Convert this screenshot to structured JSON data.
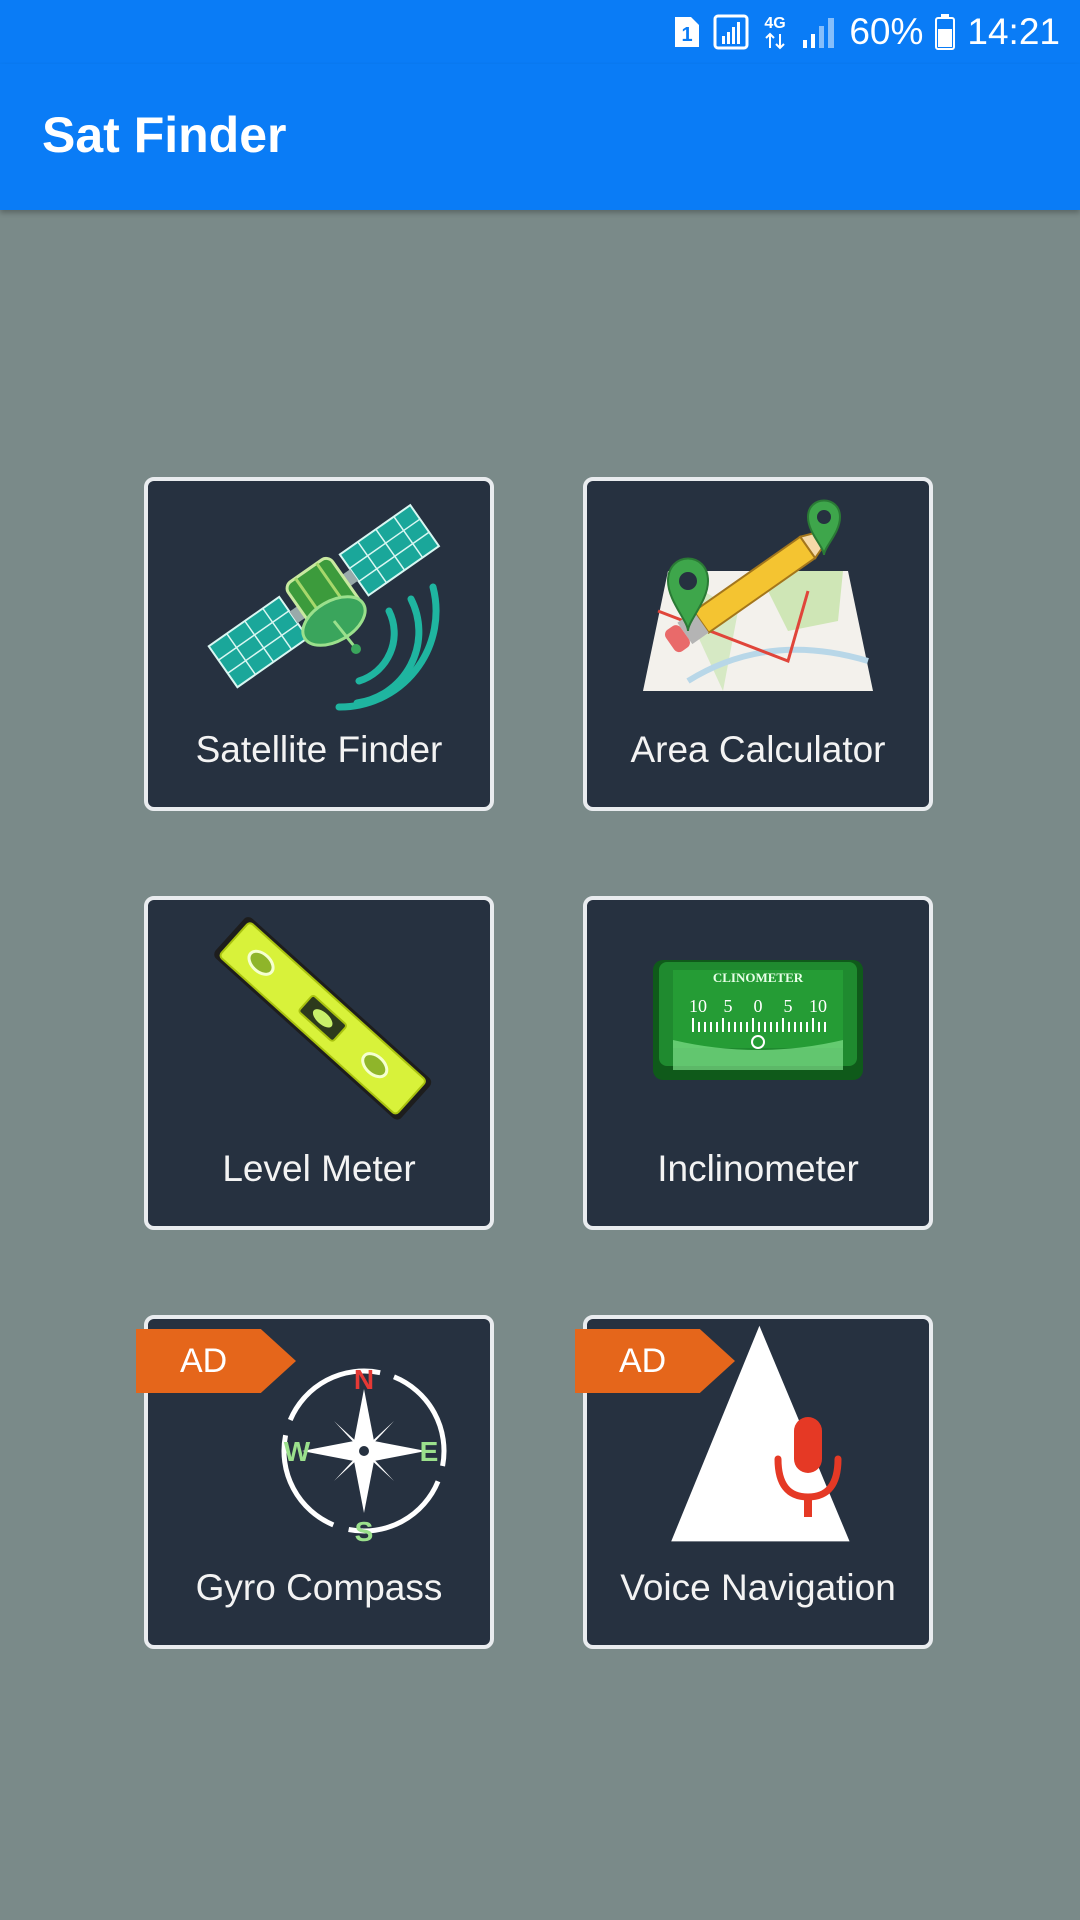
{
  "status_bar": {
    "sim_label": "1",
    "network_label": "4G",
    "battery": "60%",
    "time": "14:21",
    "icons": [
      "sim-icon",
      "signal-icon",
      "network-4g-icon",
      "signal-icon",
      "battery-icon"
    ]
  },
  "app_bar": {
    "title": "Sat Finder"
  },
  "tiles": [
    {
      "label": "Satellite Finder",
      "icon": "satellite-icon",
      "ad": ""
    },
    {
      "label": "Area Calculator",
      "icon": "map-pencil-icon",
      "ad": ""
    },
    {
      "label": "Level Meter",
      "icon": "spirit-level-icon",
      "ad": ""
    },
    {
      "label": "Inclinometer",
      "icon": "clinometer-icon",
      "ad": "",
      "icon_text": "CLINOMETER",
      "scale": [
        "10",
        "5",
        "0",
        "5",
        "10"
      ]
    },
    {
      "label": "Gyro Compass",
      "icon": "compass-icon",
      "ad": "AD",
      "compass": [
        "N",
        "E",
        "S",
        "W"
      ]
    },
    {
      "label": "Voice Navigation",
      "icon": "voice-nav-icon",
      "ad": "AD"
    }
  ],
  "colors": {
    "primary": "#0a7cf6",
    "background": "#7a8a89",
    "tile": "#263140",
    "tile_border": "#e9ecef",
    "ad_badge": "#e5661b"
  }
}
